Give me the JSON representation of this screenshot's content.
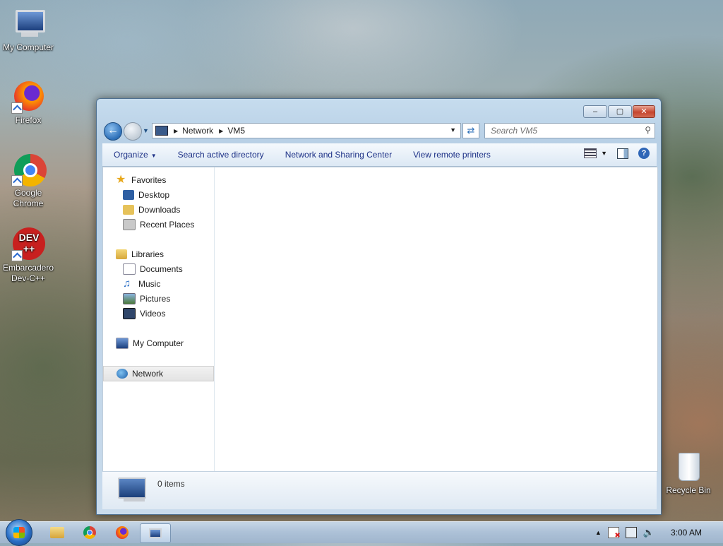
{
  "desktop": {
    "icons": [
      {
        "label": "My Computer",
        "icon": "computer-icon"
      },
      {
        "label": "Firefox",
        "icon": "firefox-icon"
      },
      {
        "label": "Google Chrome",
        "icon": "chrome-icon"
      },
      {
        "label": "Embarcadero Dev-C++",
        "icon": "devcpp-icon",
        "glyph": "DEV"
      },
      {
        "label": "Recycle Bin",
        "icon": "recycle-bin-icon"
      }
    ]
  },
  "window": {
    "caption_buttons": {
      "minimize": "‒",
      "maximize": "▢",
      "close": "✕"
    },
    "address": {
      "crumbs": [
        "Network",
        "VM5"
      ]
    },
    "search": {
      "placeholder": "Search VM5"
    },
    "commands": {
      "organize": "Organize",
      "search_ad": "Search active directory",
      "network_center": "Network and Sharing Center",
      "remote_printers": "View remote printers"
    },
    "nav": {
      "favorites": "Favorites",
      "desktop": "Desktop",
      "downloads": "Downloads",
      "recent": "Recent Places",
      "libraries": "Libraries",
      "documents": "Documents",
      "music": "Music",
      "pictures": "Pictures",
      "videos": "Videos",
      "my_computer": "My Computer",
      "network": "Network"
    },
    "details": {
      "count": "0 items"
    }
  },
  "taskbar": {
    "items": [
      "explorer-icon",
      "chrome-icon",
      "firefox-icon",
      "network-window-icon"
    ],
    "clock": "3:00 AM"
  },
  "colors": {
    "accent": "#1e3287",
    "close": "#c6452e"
  }
}
